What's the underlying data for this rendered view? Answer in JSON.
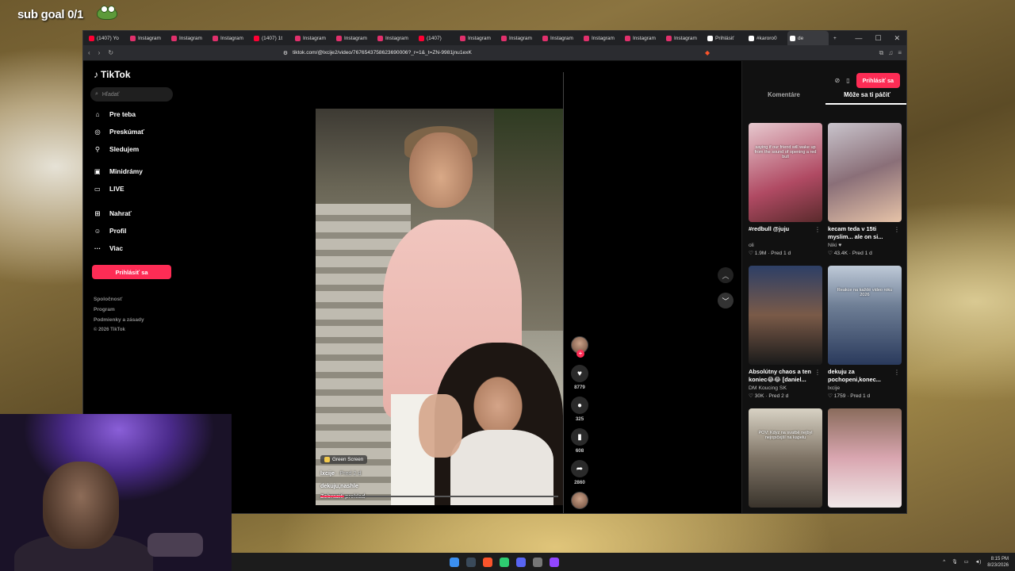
{
  "overlay": {
    "sub_goal": "sub goal 0/1"
  },
  "browser": {
    "tabs": [
      {
        "label": "(1407) Yo",
        "color": "#ff0033"
      },
      {
        "label": "Instagram",
        "color": "#e1306c"
      },
      {
        "label": "Instagram",
        "color": "#e1306c"
      },
      {
        "label": "Instagram",
        "color": "#e1306c"
      },
      {
        "label": "(1407) 1t",
        "color": "#ff0033"
      },
      {
        "label": "Instagram",
        "color": "#e1306c"
      },
      {
        "label": "Instagram",
        "color": "#e1306c"
      },
      {
        "label": "Instagram",
        "color": "#e1306c"
      },
      {
        "label": "(1407)",
        "color": "#ff0033"
      },
      {
        "label": "Instagram",
        "color": "#e1306c"
      },
      {
        "label": "Instagram",
        "color": "#e1306c"
      },
      {
        "label": "Instagram",
        "color": "#e1306c"
      },
      {
        "label": "Instagram",
        "color": "#e1306c"
      },
      {
        "label": "Instagram",
        "color": "#e1306c"
      },
      {
        "label": "Instagram",
        "color": "#e1306c"
      },
      {
        "label": "Prihlásiť",
        "color": "#ffffff"
      },
      {
        "label": "#karoro0",
        "color": "#ffffff"
      },
      {
        "label": "de",
        "color": "#ffffff"
      }
    ],
    "url": "tiktok.com/@lxcije2/video/7676543758623690006?_r=1&_t=ZN-9981jnu1exK"
  },
  "tiktok": {
    "logo": "TikTok",
    "search_placeholder": "Hľadať",
    "nav": [
      "Pre teba",
      "Preskúmať",
      "Sledujem",
      "Minidrámy",
      "LIVE",
      "Nahrať",
      "Profil",
      "Viac"
    ],
    "login": "Prihlásiť sa",
    "footer": [
      "Spoločnosť",
      "Program",
      "Podmienky a zásady",
      "© 2026 TikTok"
    ]
  },
  "video": {
    "green_screen": "Green Screen",
    "author": "lxcije",
    "date": " · Pred 2 d",
    "caption": "dekuju,nashle",
    "translate": "Zobraziť preklad",
    "progress": 0.1,
    "likes": "8779",
    "comments": "325",
    "saves": "608",
    "shares": "2860"
  },
  "right": {
    "login": "Prihlásiť sa",
    "tab_comments": "Komentáre",
    "tab_related": "Môže sa ti páčiť",
    "cards": [
      {
        "title": "#redbull @juju",
        "author": "oli",
        "stats": "♡ 1.9M · Pred 1 d",
        "overlay": "saying if our friend will wake up from the sound of opening a red bull",
        "bg": "linear-gradient(160deg,#e7c9cf,#b04a63 60%,#5a2a2c)"
      },
      {
        "title": "kecam teda v 15ti myslim... ale on si...",
        "author": "Niki ♥",
        "stats": "♡ 43.4K · Pred 1 d",
        "overlay": "",
        "bg": "linear-gradient(160deg,#c9c4cc,#8a6f78 50%,#e6c3a8)"
      },
      {
        "title": "Absolútny chaos a ten koniec😂😂 [daniel...",
        "author": "DM Koucing SK",
        "stats": "♡ 30K · Pred 2 d",
        "overlay": "",
        "bg": "linear-gradient(180deg,#2d3f66,#7a5a48 50%,#1a1a1a)"
      },
      {
        "title": "dekuju za pochopeni,konec...",
        "author": "lxcije",
        "stats": "♡ 1759 · Pred 1 d",
        "overlay": "Reakce na každé video roku 2026",
        "bg": "linear-gradient(180deg,#bfcad8,#6f7f96 40%,#2a3a5c)"
      },
      {
        "title": "",
        "author": "",
        "stats": "",
        "overlay": "POV: Kdyz na svatbě nejbyl nejopičejší na kapelu",
        "bg": "linear-gradient(180deg,#d8d2c4,#7f7466 50%,#3a342c)"
      },
      {
        "title": "",
        "author": "",
        "stats": "",
        "overlay": "",
        "bg": "linear-gradient(180deg,#8a6c5c,#d9a6b0 50%,#f0e8e8)"
      }
    ]
  },
  "taskbar": {
    "time": "8:15 PM",
    "date": "8/23/2026"
  }
}
